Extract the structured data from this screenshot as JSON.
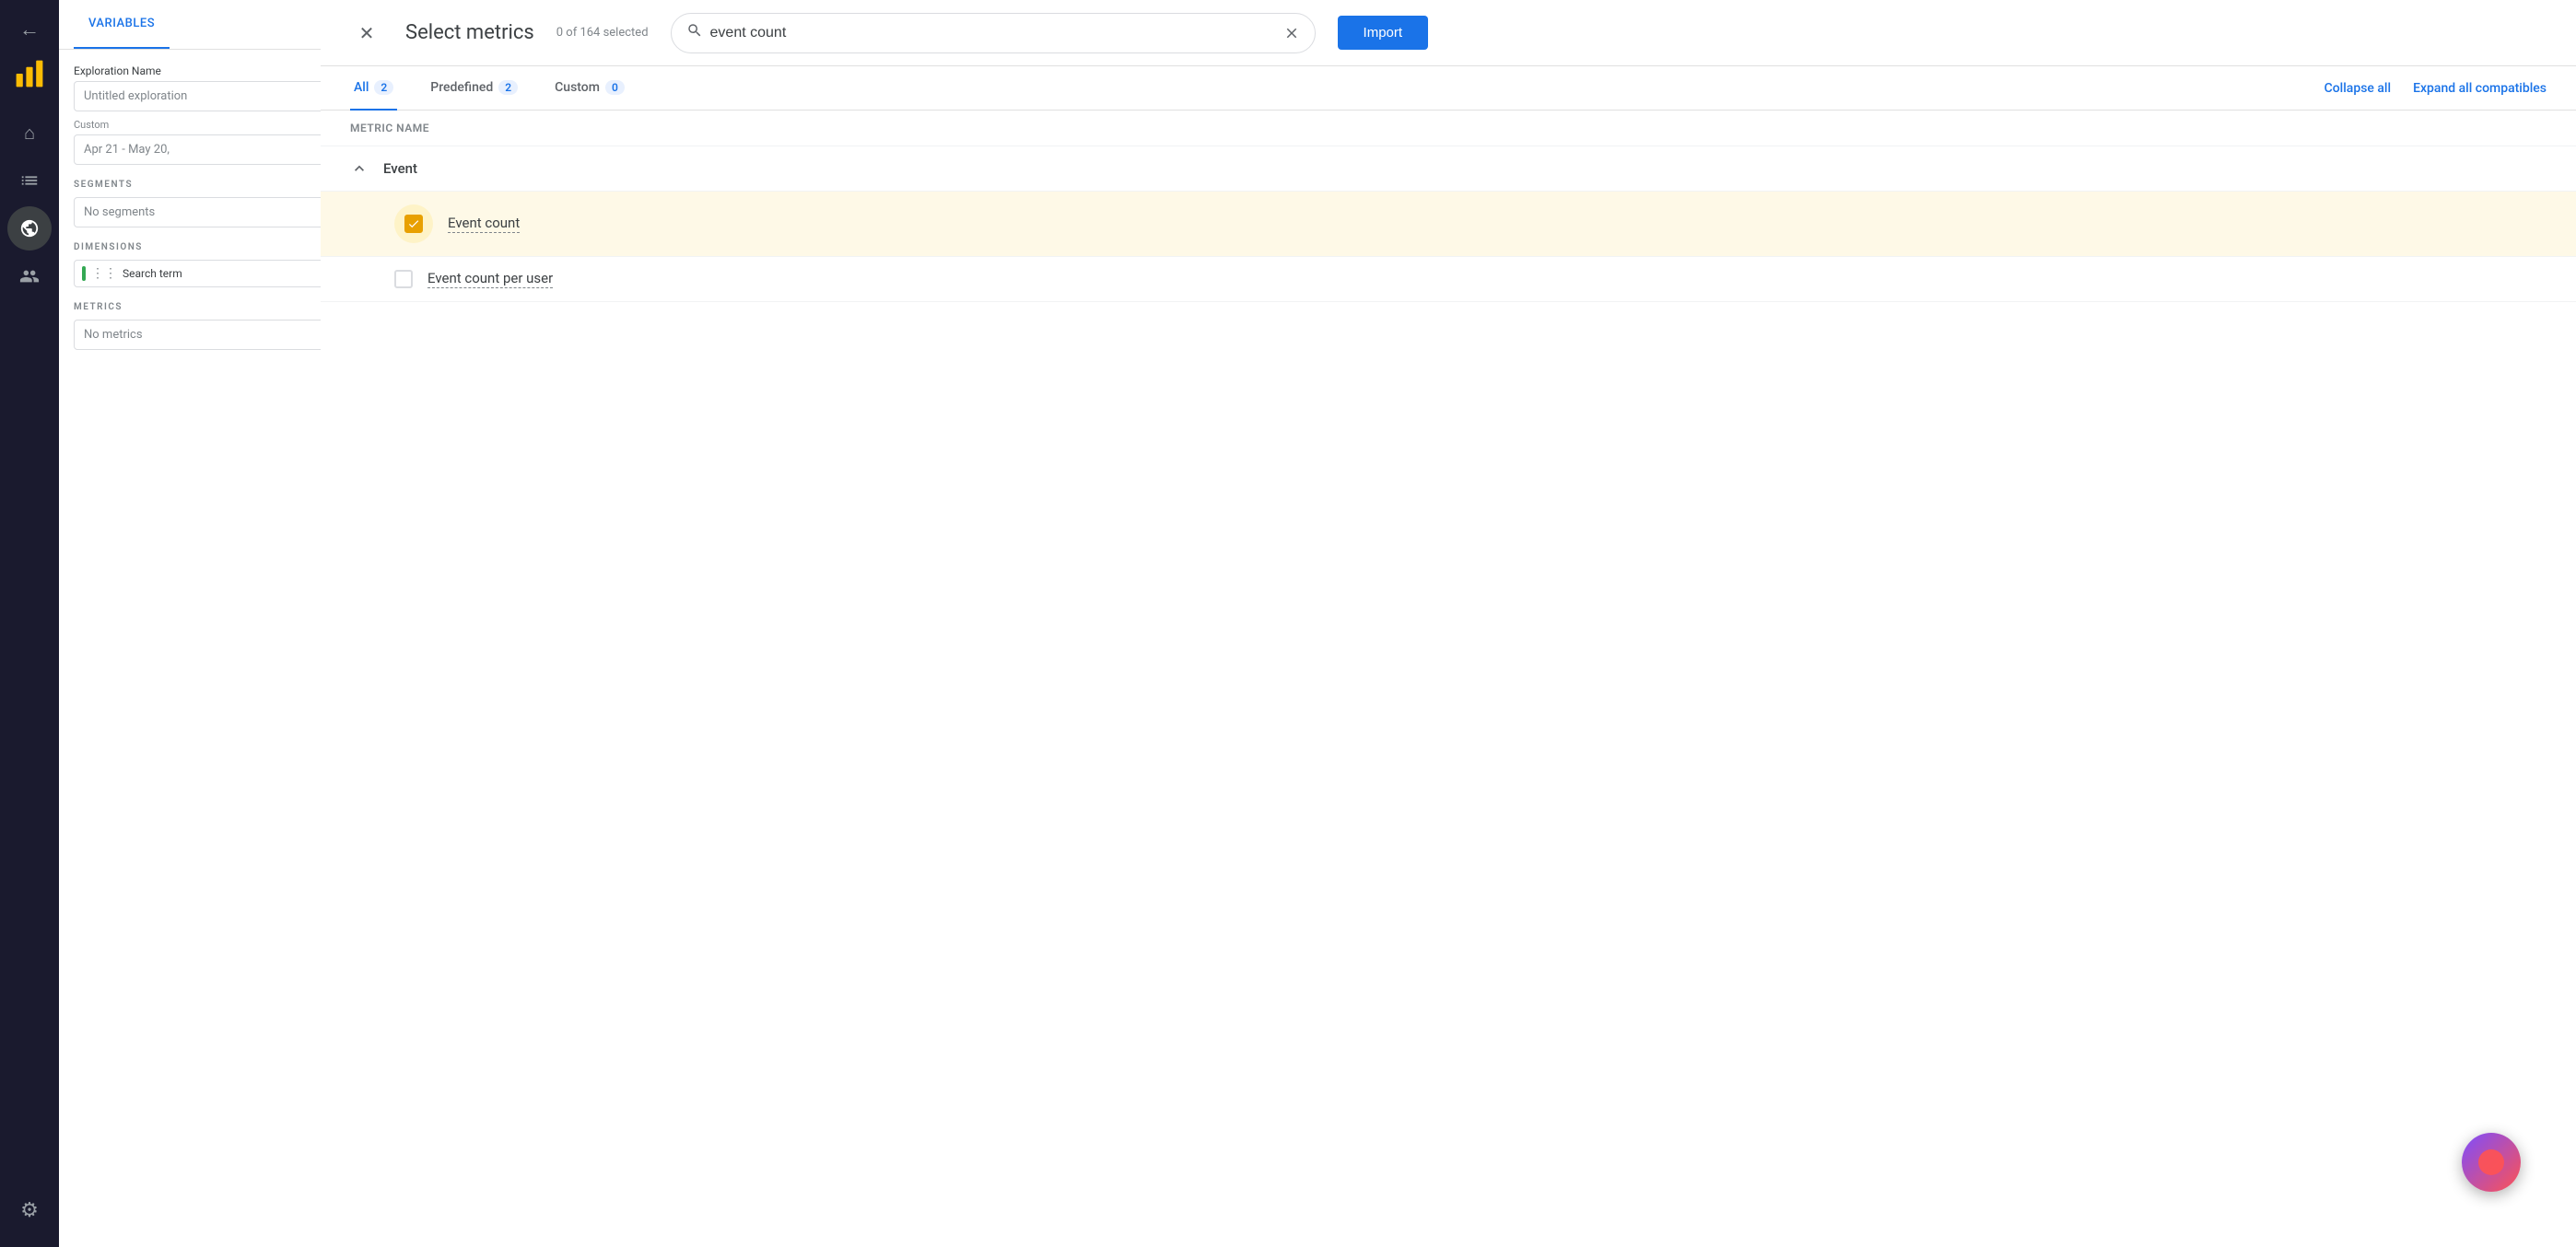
{
  "app": {
    "title": "Analytics",
    "back_label": "←"
  },
  "nav": {
    "items": [
      {
        "id": "home",
        "icon": "⌂",
        "active": false
      },
      {
        "id": "chart",
        "icon": "📊",
        "active": false
      },
      {
        "id": "explore",
        "icon": "✦",
        "active": true
      }
    ],
    "settings_icon": "⚙"
  },
  "variables_panel": {
    "tab_label": "Variables",
    "exploration_name_label": "Exploration Name",
    "exploration_name_value": "Untitled exploration",
    "date_type_label": "Custom",
    "date_range_label": "Apr 21 - May 20,",
    "segments_label": "Segments",
    "segments_placeholder": "No segments",
    "dimensions_label": "Dimensions",
    "dimensions_chip_label": "Search term",
    "metrics_label": "Metrics",
    "metrics_placeholder": "No metrics"
  },
  "modal": {
    "title": "Select metrics",
    "count_text": "0 of 164 selected",
    "search_placeholder": "event count",
    "search_value": "event count",
    "import_btn_label": "Import",
    "close_icon": "✕",
    "search_icon": "🔍",
    "clear_icon": "✕",
    "tabs": [
      {
        "id": "all",
        "label": "All",
        "badge": "2",
        "active": true
      },
      {
        "id": "predefined",
        "label": "Predefined",
        "badge": "2",
        "active": false
      },
      {
        "id": "custom",
        "label": "Custom",
        "badge": "0",
        "active": false
      }
    ],
    "collapse_all_label": "Collapse all",
    "expand_all_label": "Expand all compatibles",
    "metric_name_header": "Metric name",
    "categories": [
      {
        "id": "event",
        "name": "Event",
        "expanded": true,
        "metrics": [
          {
            "id": "event-count",
            "name": "Event count",
            "checked": true,
            "highlighted": true
          },
          {
            "id": "event-count-per-user",
            "name": "Event count per user",
            "checked": false,
            "highlighted": false
          }
        ]
      }
    ]
  },
  "fab": {
    "aria_label": "Help"
  },
  "colors": {
    "active_tab": "#1a73e8",
    "checked_checkbox": "#e8a000",
    "highlight_bg": "#fef9e7",
    "dimension_bar": "#34a853"
  }
}
